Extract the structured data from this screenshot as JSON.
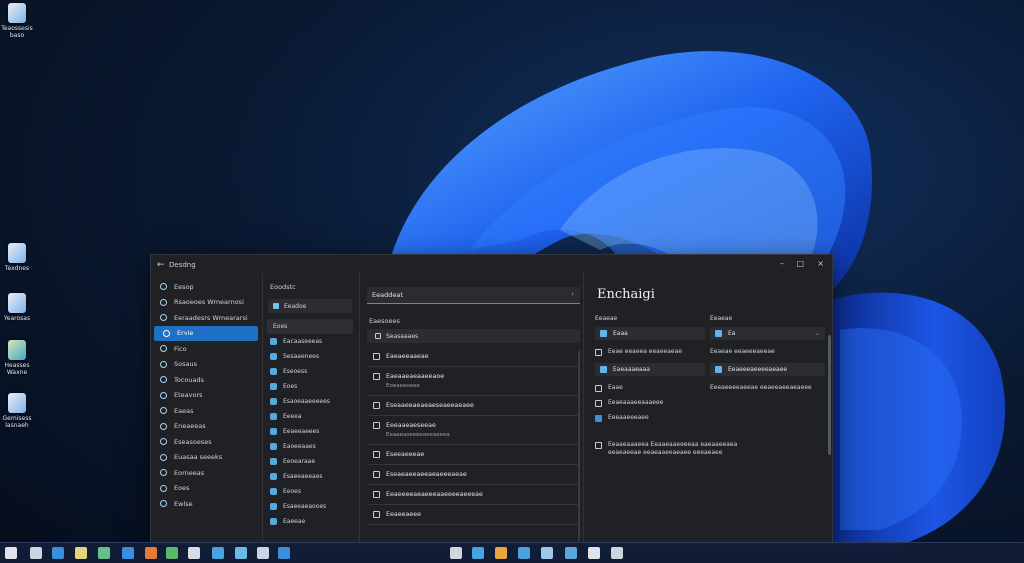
{
  "desktop": {
    "icons": [
      {
        "label": "Teaossesis\nbaso",
        "icon": "document-icon"
      },
      {
        "label": "Texdnes",
        "icon": "document-icon"
      },
      {
        "label": "Yearosas",
        "icon": "document-icon"
      },
      {
        "label": "Heasses\nWaxne",
        "icon": "photo-icon"
      },
      {
        "label": "Gemisess\nlasnaeh",
        "icon": "document-icon"
      }
    ]
  },
  "window": {
    "title": "Desdng",
    "back_glyph": "←",
    "controls": {
      "minimize": "–",
      "maximize": "□",
      "close": "×"
    }
  },
  "nav": {
    "items": [
      {
        "label": "Eesop",
        "icon": "home-icon"
      },
      {
        "label": "Rsaoeoes Wmearnosi",
        "icon": "system-icon"
      },
      {
        "label": "Eeraadesrs Wmeararsi",
        "icon": "bluetooth-icon"
      },
      {
        "label": "Ervie",
        "icon": "network-icon",
        "active": true
      },
      {
        "label": "Fico",
        "icon": "personalization-icon"
      },
      {
        "label": "Sosaus",
        "icon": "apps-icon"
      },
      {
        "label": "Tocouads",
        "icon": "accounts-icon"
      },
      {
        "label": "Eteavors",
        "icon": "time-icon"
      },
      {
        "label": "Eaeas",
        "icon": "gaming-icon"
      },
      {
        "label": "Eneaeeas",
        "icon": "accessibility-icon"
      },
      {
        "label": "Eseasoeses",
        "icon": "privacy-icon"
      },
      {
        "label": "Euasaa seeeks",
        "icon": "update-icon"
      },
      {
        "label": "Eorneeas",
        "icon": "help-icon"
      },
      {
        "label": "Eoes",
        "icon": "info-icon"
      },
      {
        "label": "Ewlse",
        "icon": "settings-icon"
      }
    ]
  },
  "middle": {
    "header": "Eoodstc",
    "search_value": "Eeadoe",
    "section": "Eoes",
    "items": [
      {
        "label": "Eacaaseeeas"
      },
      {
        "label": "Sesaaenees"
      },
      {
        "label": "Eseoess"
      },
      {
        "label": "Eoes"
      },
      {
        "label": "Esaoeaaeeeees"
      },
      {
        "label": "Eeeea"
      },
      {
        "label": "Eeaeeaeees"
      },
      {
        "label": "Eaoeeaaes"
      },
      {
        "label": "Eeoearaae"
      },
      {
        "label": "Esaeeaeeaes"
      },
      {
        "label": "Eeoes"
      },
      {
        "label": "Esaeeaeaooes"
      },
      {
        "label": "Eaeeae"
      }
    ]
  },
  "detail": {
    "field_value": "Eeaddeat",
    "field_chevron": "›",
    "section": "Eaesoees",
    "card": "Seasaaaes",
    "items": [
      {
        "title": "Eaeaeeaaeae",
        "sub": ""
      },
      {
        "title": "Eaeaaeaeaaeeaoe",
        "sub": "Eoeaeeoeee"
      },
      {
        "title": "Eseaaeeaeaeaeseaeeaeaee",
        "sub": ""
      },
      {
        "title": "Eeeaaeaeseeae",
        "sub": "Eeaaeaseeeeaeeaeeea"
      },
      {
        "title": "Eseeaeeeae",
        "sub": ""
      },
      {
        "title": "Eseaeaeeaeeaeaeeeaeae",
        "sub": ""
      },
      {
        "title": "Eeaeeeeaeaeeeaaeeeeaeeeae",
        "sub": ""
      },
      {
        "title": "Eeaeeaeee",
        "sub": ""
      }
    ]
  },
  "right": {
    "title": "Enchaigi",
    "left_label": "Eeaeae",
    "right_label": "Eeaeae",
    "left_box": "Eaaa",
    "right_box": "Ea",
    "left_text1": "Eeae eeaeea eeaeeaeae",
    "right_text1": "Eeaeae eeaeeeaeeae",
    "left_box2": "Eaeaaaeaaa",
    "right_box2": "Eeaeeeaeeeeaeaee",
    "left_text2": "Eaae",
    "right_text2": "Eeeaeeeeaeeae eeaeeaeeaeaeee",
    "left_text3": "Eeaeaaaeeaaaeee",
    "left_text4": "Eeeaaeeeaee",
    "bottom_text": "Eeaaeaaaeea Eeaaeaaeeeeaa eaeaaeeaea eeaeaeeae eeaeaaeeaeaee eeeaeaee"
  },
  "taskbar": {
    "colors": [
      "#dfe4ea",
      "#ccd6e0",
      "#3b8fda",
      "#e6d27a",
      "#68c18b",
      "#3b8fda",
      "#e07b3c",
      "#5cb96b",
      "#d7dde5",
      "#4aa3df",
      "#6cb9e8",
      "#c9d6e4",
      "#3b8fda",
      "#cfd6de",
      "#4aa3df",
      "#e9a640",
      "#4aa3df",
      "#9fc7ea",
      "#5aa7e0"
    ]
  }
}
